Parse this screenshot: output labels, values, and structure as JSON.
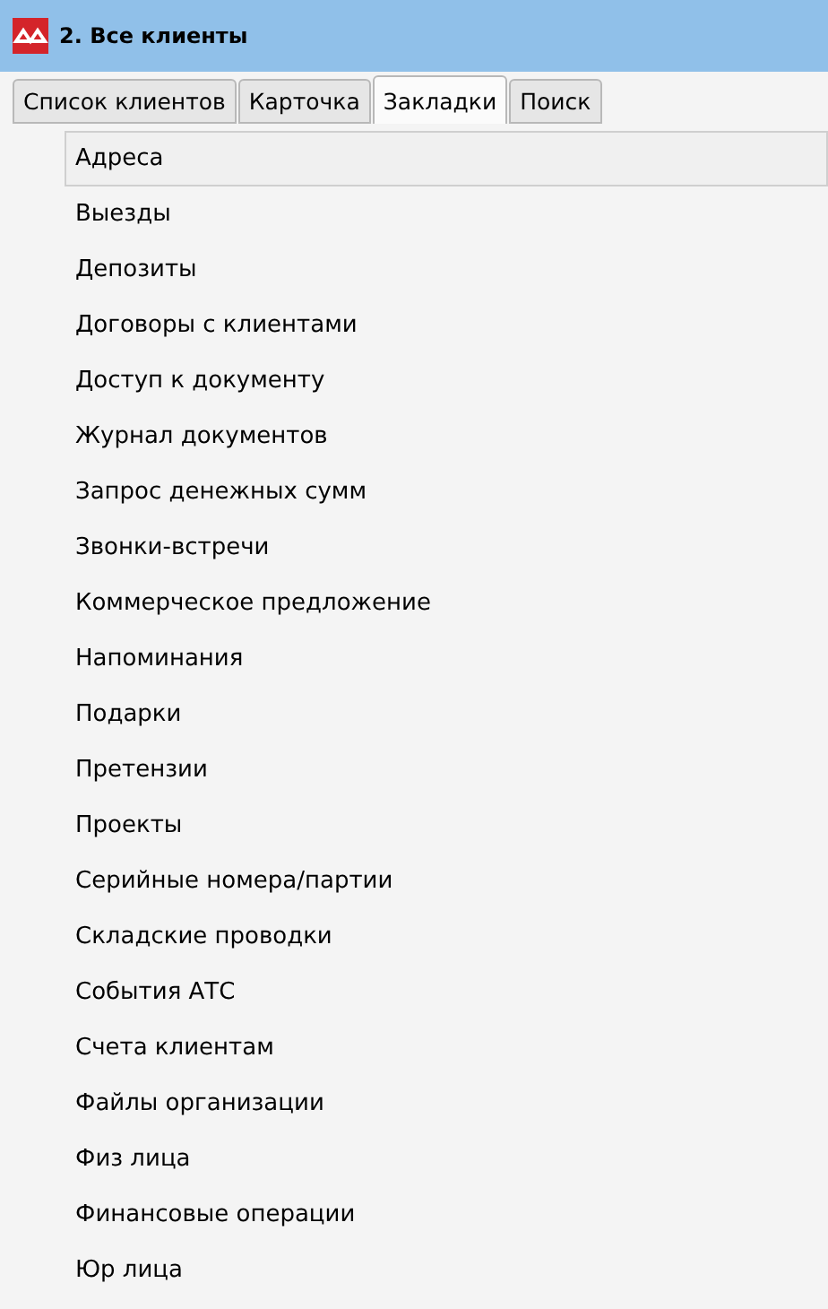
{
  "window": {
    "title": "2. Все клиенты"
  },
  "tabs": [
    {
      "label": "Список клиентов",
      "selected": false
    },
    {
      "label": "Карточка",
      "selected": false
    },
    {
      "label": "Закладки",
      "selected": true
    },
    {
      "label": "Поиск",
      "selected": false
    }
  ],
  "list": [
    {
      "label": "Адреса",
      "selected": true
    },
    {
      "label": "Выезды",
      "selected": false
    },
    {
      "label": "Депозиты",
      "selected": false
    },
    {
      "label": "Договоры с клиентами",
      "selected": false
    },
    {
      "label": "Доступ к документу",
      "selected": false
    },
    {
      "label": "Журнал документов",
      "selected": false
    },
    {
      "label": "Запрос денежных сумм",
      "selected": false
    },
    {
      "label": "Звонки-встречи",
      "selected": false
    },
    {
      "label": "Коммерческое предложение",
      "selected": false
    },
    {
      "label": "Напоминания",
      "selected": false
    },
    {
      "label": "Подарки",
      "selected": false
    },
    {
      "label": "Претензии",
      "selected": false
    },
    {
      "label": "Проекты",
      "selected": false
    },
    {
      "label": "Серийные номера/партии",
      "selected": false
    },
    {
      "label": "Складские проводки",
      "selected": false
    },
    {
      "label": "События АТС",
      "selected": false
    },
    {
      "label": "Счета клиентам",
      "selected": false
    },
    {
      "label": "Файлы организации",
      "selected": false
    },
    {
      "label": "Физ лица",
      "selected": false
    },
    {
      "label": "Финансовые операции",
      "selected": false
    },
    {
      "label": "Юр лица",
      "selected": false
    }
  ]
}
